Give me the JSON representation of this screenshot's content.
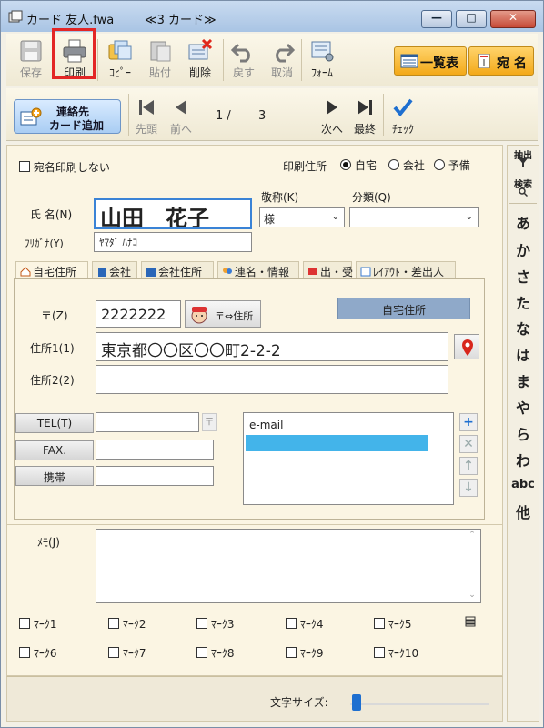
{
  "window": {
    "title": "カード 友人.fwa",
    "subtitle": "≪3 カード≫",
    "minimize": "—",
    "maximize": "□",
    "close": "✕"
  },
  "toolbar": {
    "save": "保存",
    "print": "印刷",
    "copy": "ｺﾋﾟｰ",
    "paste": "貼付",
    "delete": "削除",
    "undo": "戻す",
    "redo": "取消",
    "form": "ﾌｫｰﾑ",
    "list_view": "一覧表",
    "address": "宛 名"
  },
  "nav": {
    "add_contact_line1": "連絡先",
    "add_contact_line2": "カード追加",
    "first": "先頭",
    "prev": "前へ",
    "current": "1 /",
    "total": "3",
    "next": "次へ",
    "last": "最終",
    "check": "ﾁｪｯｸ"
  },
  "form": {
    "no_print_label": "宛名印刷しない",
    "print_address_label": "印刷住所",
    "radio_home": "自宅",
    "radio_company": "会社",
    "radio_spare": "予備",
    "name_label": "氏 名(N)",
    "name_value": "山田　花子",
    "furigana_label": "ﾌﾘｶﾞﾅ(Y)",
    "furigana_value": "ﾔﾏﾀﾞ ﾊﾅｺ",
    "honorific_label": "敬称(K)",
    "honorific_value": "様",
    "category_label": "分類(Q)",
    "category_value": ""
  },
  "tabs": [
    {
      "label": "自宅住所"
    },
    {
      "label": "会社"
    },
    {
      "label": "会社住所"
    },
    {
      "label": "連名・情報"
    },
    {
      "label": "出・受"
    },
    {
      "label": "ﾚｲｱｳﾄ・差出人"
    }
  ],
  "address": {
    "postal_label": "〒(Z)",
    "postal_value": "2222222",
    "postal_convert": "〒⇔住所",
    "type_badge": "自宅住所",
    "addr1_label": "住所1(1)",
    "addr1_value": "東京都〇〇区〇〇町2-2-2",
    "addr2_label": "住所2(2)",
    "addr2_value": "",
    "tel_label": "TEL(T)",
    "tel_value": "",
    "fax_label": "FAX.",
    "fax_value": "",
    "mobile_label": "携帯",
    "mobile_value": "",
    "email_label": "e-mail",
    "add_email": "+",
    "remove_email": "✕",
    "up": "↑",
    "down": "↓"
  },
  "memo": {
    "label": "ﾒﾓ(J)",
    "value": ""
  },
  "marks": [
    "ﾏｰｸ1",
    "ﾏｰｸ2",
    "ﾏｰｸ3",
    "ﾏｰｸ4",
    "ﾏｰｸ5",
    "ﾏｰｸ6",
    "ﾏｰｸ7",
    "ﾏｰｸ8",
    "ﾏｰｸ9",
    "ﾏｰｸ10"
  ],
  "status": {
    "font_size_label": "文字サイズ:"
  },
  "index": {
    "extract": "抽出",
    "search": "検索",
    "kana": [
      "あ",
      "か",
      "さ",
      "た",
      "な",
      "は",
      "ま",
      "や",
      "ら",
      "わ",
      "abc",
      "他"
    ]
  },
  "colors": {
    "highlight": "#e32626",
    "accent_blue": "#1e6fd0",
    "selection": "#43b4ea"
  }
}
